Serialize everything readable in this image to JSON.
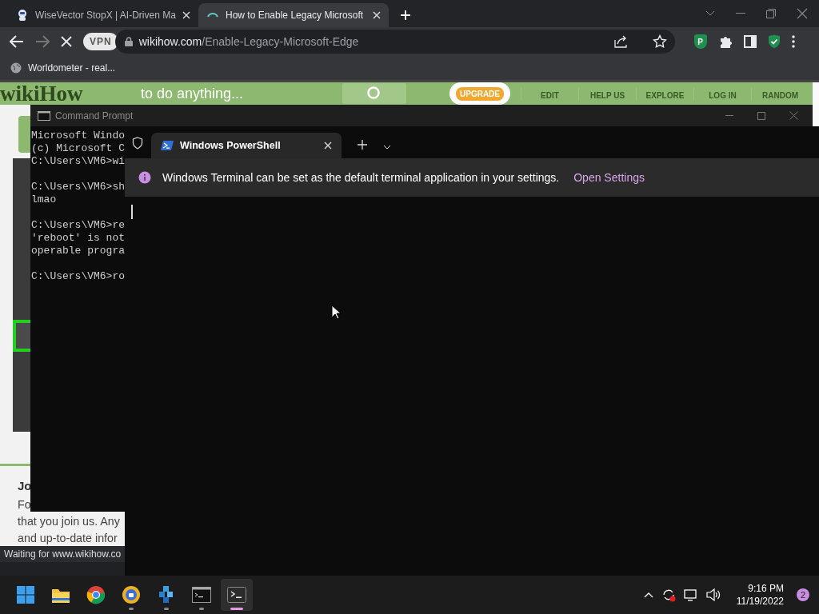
{
  "browser": {
    "tabs": [
      {
        "title": "WiseVector StopX | AI-Driven Ma",
        "selected": false,
        "loading": false
      },
      {
        "title": "How to Enable Legacy Microsoft",
        "selected": true,
        "loading": true
      }
    ],
    "vpn_badge": "VPN",
    "address": {
      "domain": "wikihow.com",
      "path": "/Enable-Legacy-Microsoft-Edge"
    },
    "extension_badge": "P",
    "bookmarks": [
      {
        "label": "Worldometer - real..."
      }
    ],
    "status": "Waiting for www.wikihow.co"
  },
  "wikihow": {
    "logo": "wikiHow",
    "tagline": "to do anything...",
    "upgrade": "UPGRADE",
    "nav": [
      "EDIT",
      "HELP US",
      "EXPLORE",
      "LOG IN",
      "RANDOM"
    ],
    "heading": "Jo",
    "lines": [
      "Fo",
      "that you join us. Any",
      "and up-to-date infor"
    ]
  },
  "command_prompt": {
    "title": "Command Prompt",
    "blocks": [
      [
        "Microsoft Windo",
        "(c) Microsoft C",
        "C:\\Users\\VM6>wi"
      ],
      [
        "C:\\Users\\VM6>sh",
        "lmao"
      ],
      [
        "C:\\Users\\VM6>re",
        "'reboot' is not",
        "operable progra"
      ],
      [
        "C:\\Users\\VM6>ro"
      ]
    ]
  },
  "terminal": {
    "tab": "Windows PowerShell",
    "notice": "Windows Terminal can be set as the default terminal application in your settings.",
    "notice_link": "Open Settings"
  },
  "taskbar": {
    "apps": [
      {
        "kind": "start",
        "running": false,
        "active": false
      },
      {
        "kind": "explorer",
        "running": false,
        "active": false
      },
      {
        "kind": "chrome",
        "running": false,
        "active": false
      },
      {
        "kind": "browser",
        "running": true,
        "active": false
      },
      {
        "kind": "cubes",
        "running": true,
        "active": false
      },
      {
        "kind": "cmd",
        "running": true,
        "active": false
      },
      {
        "kind": "terminal",
        "running": true,
        "active": true
      }
    ],
    "time": "9:16 PM",
    "date": "11/19/2022",
    "notifications": "2"
  }
}
